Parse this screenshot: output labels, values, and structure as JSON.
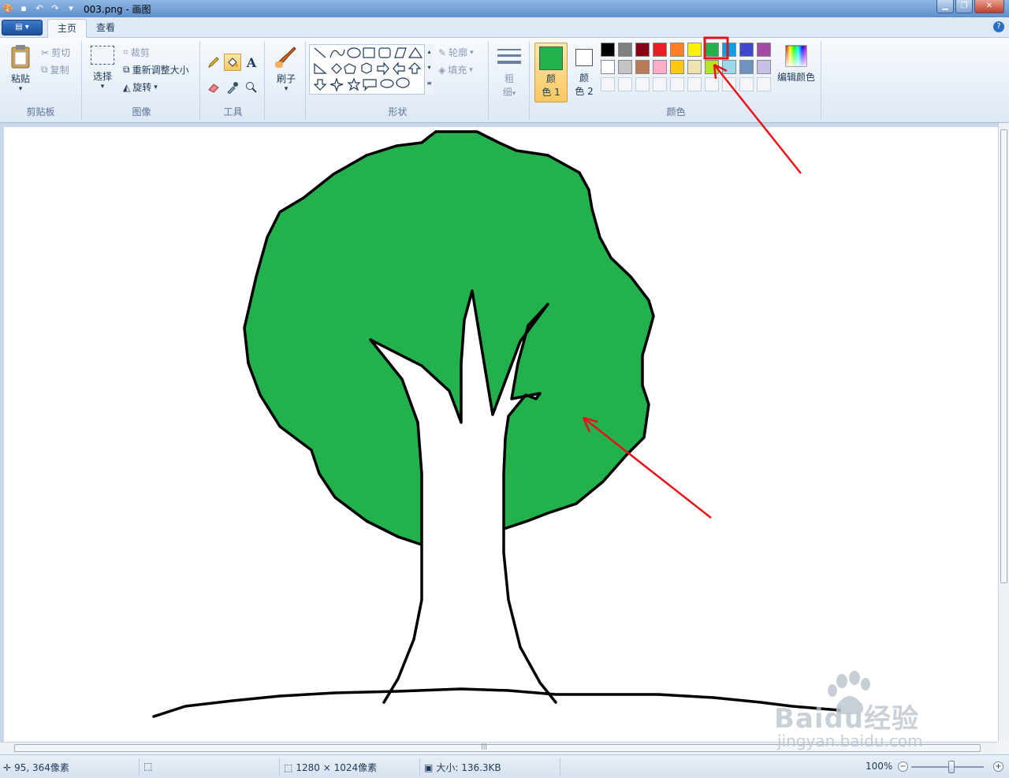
{
  "window": {
    "title": "003.png - 画图"
  },
  "tabs": [
    {
      "label": "主页",
      "active": true
    },
    {
      "label": "查看",
      "active": false
    }
  ],
  "ribbon": {
    "clipboard": {
      "group": "剪贴板",
      "paste": "粘贴",
      "cut": "剪切",
      "copy": "复制"
    },
    "image": {
      "group": "图像",
      "select": "选择",
      "crop": "裁剪",
      "resize": "重新调整大小",
      "rotate": "旋转"
    },
    "tools": {
      "group": "工具"
    },
    "brushes": {
      "label": "刷子"
    },
    "shapes": {
      "group": "形状",
      "outline": "轮廓",
      "fill": "填充"
    },
    "size": {
      "line1": "粗",
      "line2": "细"
    },
    "colors": {
      "group": "颜色",
      "color1_line1": "颜",
      "color1_line2": "色 1",
      "color1_value": "#22b14c",
      "color2_line1": "颜",
      "color2_line2": "色 2",
      "color2_value": "#ffffff",
      "edit": "编辑颜色",
      "palette_row1": [
        "#000000",
        "#7f7f7f",
        "#880015",
        "#ed1c24",
        "#ff7f27",
        "#fff200",
        "#22b14c",
        "#00a2e8",
        "#3f48cc",
        "#a349a4"
      ],
      "palette_row2": [
        "#ffffff",
        "#c3c3c3",
        "#b97a57",
        "#ffaec9",
        "#ffc90e",
        "#efe4b0",
        "#b5e61d",
        "#99d9ea",
        "#7092be",
        "#c8bfe7"
      ],
      "selected_index": 6
    }
  },
  "status": {
    "cursor": "95, 364像素",
    "dimensions": "1280 × 1024像素",
    "size": "大小: 136.3KB",
    "zoom": "100%"
  },
  "watermark": {
    "brand": "Baidu经验",
    "url": "jingyan.baidu.com"
  },
  "accent": {
    "tree_green": "#22b14c",
    "arrow_red": "#e8111a"
  }
}
